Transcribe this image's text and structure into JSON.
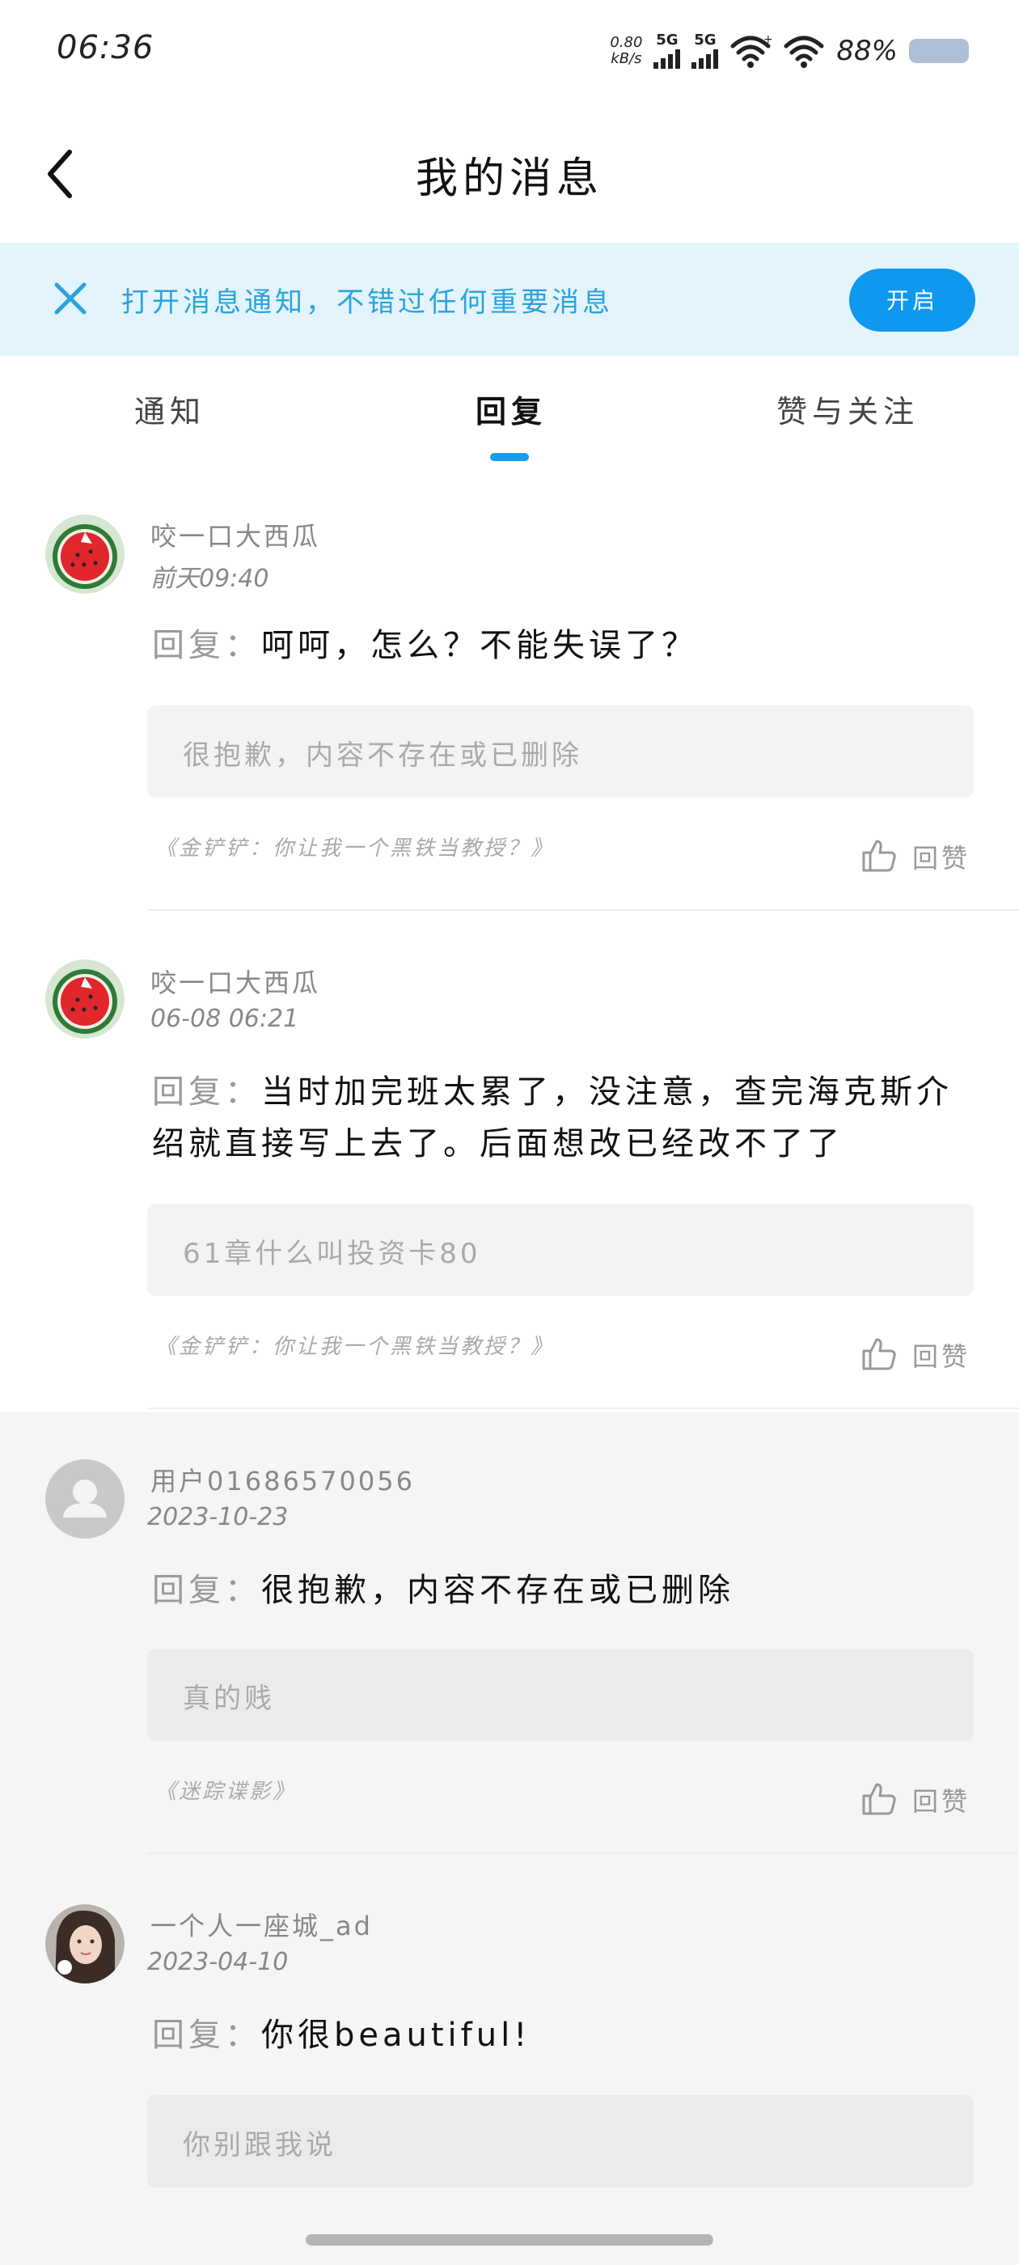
{
  "status_bar": {
    "time": "06:36",
    "net_speed_value": "0.80",
    "net_speed_unit": "kB/s",
    "signal1_label": "5G",
    "signal2_label": "5G",
    "battery_percent": "88%"
  },
  "header": {
    "title": "我的消息"
  },
  "banner": {
    "text": "打开消息通知，不错过任何重要消息",
    "button_label": "开启"
  },
  "tabs": [
    {
      "label": "通知"
    },
    {
      "label": "回复",
      "active": true
    },
    {
      "label": "赞与关注"
    }
  ],
  "reply_prefix": "回复：",
  "like_label": "回赞",
  "messages": [
    {
      "user": "咬一口大西瓜",
      "time": "前天09:40",
      "reply": "呵呵，怎么？不能失误了？",
      "quote": "很抱歉，内容不存在或已删除",
      "source": "《金铲铲：你让我一个黑铁当教授？》",
      "avatar": "watermelon-avatar"
    },
    {
      "user": "咬一口大西瓜",
      "time": "06-08 06:21",
      "reply": "当时加完班太累了，没注意，查完海克斯介绍就直接写上去了。后面想改已经改不了了",
      "quote": "61章什么叫投资卡80",
      "source": "《金铲铲：你让我一个黑铁当教授？》",
      "avatar": "watermelon-avatar"
    },
    {
      "user": "用户01686570056",
      "time": "2023-10-23",
      "reply": "很抱歉，内容不存在或已删除",
      "quote": "真的贱",
      "source": "《迷踪谍影》",
      "avatar": "default-user-avatar"
    },
    {
      "user": "一个人一座城_ad",
      "time": "2023-04-10",
      "reply": "你很beautiful!",
      "quote": "你别跟我说",
      "source": "",
      "avatar": "photo-avatar"
    }
  ],
  "colors": {
    "accent": "#0e98f0",
    "banner_bg": "#e3f4fc",
    "banner_text": "#2ba3dc",
    "tab_indicator": "#1a9be8"
  }
}
